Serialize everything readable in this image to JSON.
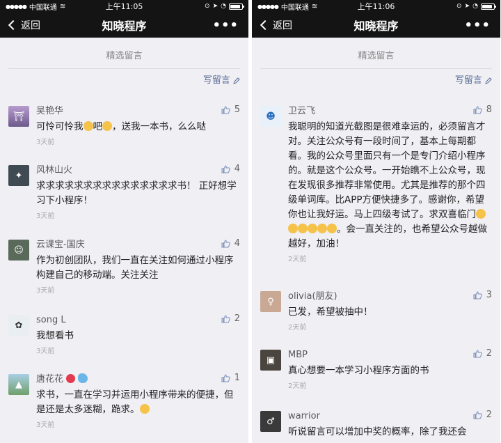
{
  "colors": {
    "bar_bg": "#141414",
    "page_bg": "#efeff4",
    "link": "#576b95"
  },
  "panels": [
    {
      "status": {
        "carrier": "中国联通",
        "time": "上午11:05"
      },
      "nav": {
        "back": "返回",
        "title": "知晓程序",
        "more": "•••"
      },
      "section_title": "精选留言",
      "write_label": "写留言",
      "comments": [
        {
          "name": "吴艳华",
          "likes": "5",
          "text_a": "可怜可怜我",
          "text_b": "吧",
          "text_c": "，送我一本书，么么哒",
          "time": "3天前"
        },
        {
          "name": "风林山火",
          "likes": "4",
          "text": "求求求求求求求求求求求求求求求书！ 正好想学习下小程序！",
          "time": "3天前"
        },
        {
          "name": "云课宝-国庆",
          "likes": "4",
          "text": "作为初创团队，我们一直在关注如何通过小程序构建自己的移动端。关注关注",
          "time": "3天前"
        },
        {
          "name": "song L",
          "likes": "2",
          "text": "我想看书",
          "time": "3天前"
        },
        {
          "name": "唐花花",
          "likes": "1",
          "text_a": "求书，一直在学习并运用小程序带来的便捷，但是还是太多迷糊，跪求。",
          "time": "3天前"
        }
      ]
    },
    {
      "status": {
        "carrier": "中国联通",
        "time": "上午11:06"
      },
      "nav": {
        "back": "返回",
        "title": "知晓程序",
        "more": "•••"
      },
      "section_title": "精选留言",
      "write_label": "写留言",
      "comments": [
        {
          "name": "卫云飞",
          "likes": "8",
          "text": "我聪明的知道光截图是很难幸运的，必须留言才对。关注公众号有一段时间了，基本上每期都看。我的公众号里面只有一个是专门介绍小程序的。就是这个公众号。一开始瞧不上公众号，现在发现很多推荐非常使用。尤其是推荐的那个四级单词库。比APP方便快捷多了。感谢你，希望你也让我好运。马上四级考试了。求双喜临门",
          "text_tail": "。会一直关注的，也希望公众号越做越好，加油！",
          "time": "2天前"
        },
        {
          "name": "olivia(朋友)",
          "likes": "3",
          "text": "已发，希望被抽中！",
          "time": "2天前"
        },
        {
          "name": "MBP",
          "likes": "2",
          "text": "真心想要一本学习小程序方面的书",
          "time": "2天前"
        },
        {
          "name": "warrior",
          "likes": "2",
          "text": "听说留言可以增加中奖的概率，除了我还会",
          "time": ""
        }
      ]
    }
  ]
}
